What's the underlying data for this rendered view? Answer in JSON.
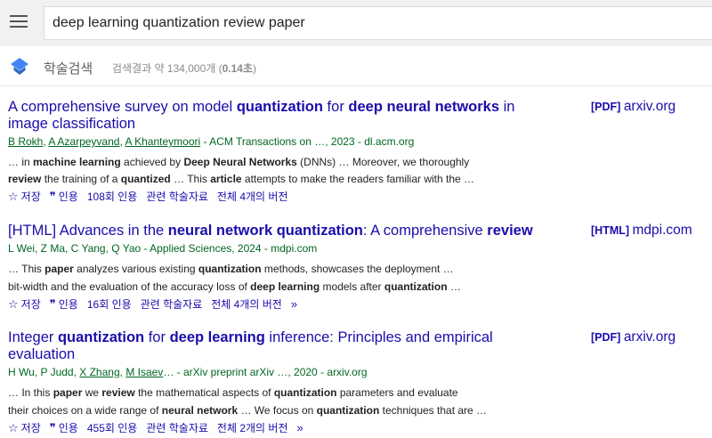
{
  "search": {
    "query": "deep learning quantization review paper"
  },
  "header": {
    "brand": "학술검색",
    "result_count_prefix": "검색결과 약 134,000개 (",
    "result_time": "0.14초",
    "result_count_suffix": ")"
  },
  "actions": {
    "save": "저장",
    "cite": "인용",
    "related": "관련 학술자료"
  },
  "results": [
    {
      "title_parts": [
        {
          "t": "A comprehensive survey on model ",
          "b": false
        },
        {
          "t": "quantization",
          "b": true
        },
        {
          "t": " for ",
          "b": false
        },
        {
          "t": "deep neural networks",
          "b": true
        },
        {
          "t": " in image classification",
          "b": false
        }
      ],
      "side_tag": "[PDF]",
      "side_domain": "arxiv.org",
      "author_parts": [
        {
          "t": "B Rokh",
          "link": true
        },
        {
          "t": ", ",
          "link": false
        },
        {
          "t": "A Azarpeyvand",
          "link": true
        },
        {
          "t": ", ",
          "link": false
        },
        {
          "t": "A Khanteymoori",
          "link": true
        },
        {
          "t": " - ACM Transactions on …, 2023 - dl.acm.org",
          "link": false
        }
      ],
      "snippet_lines": [
        [
          {
            "t": "… in ",
            "b": false
          },
          {
            "t": "machine learning",
            "b": true
          },
          {
            "t": " achieved by ",
            "b": false
          },
          {
            "t": "Deep Neural Networks",
            "b": true
          },
          {
            "t": " (DNNs) … Moreover, we thoroughly",
            "b": false
          }
        ],
        [
          {
            "t": "review",
            "b": true
          },
          {
            "t": " the training of a ",
            "b": false
          },
          {
            "t": "quantized",
            "b": true
          },
          {
            "t": " … This ",
            "b": false
          },
          {
            "t": "article",
            "b": true
          },
          {
            "t": " attempts to make the readers familiar with the …",
            "b": false
          }
        ]
      ],
      "cited": "108회 인용",
      "versions": "전체 4개의 버전",
      "more": false
    },
    {
      "title_parts": [
        {
          "t": "[HTML] ",
          "b": false
        },
        {
          "t": "Advances in the ",
          "b": false
        },
        {
          "t": "neural network quantization",
          "b": true
        },
        {
          "t": ": A comprehensive ",
          "b": false
        },
        {
          "t": "review",
          "b": true
        }
      ],
      "side_tag": "[HTML]",
      "side_domain": "mdpi.com",
      "author_parts": [
        {
          "t": "L Wei, Z Ma, C Yang, Q Yao - Applied Sciences, 2024 - mdpi.com",
          "link": false
        }
      ],
      "snippet_lines": [
        [
          {
            "t": "… This ",
            "b": false
          },
          {
            "t": "paper",
            "b": true
          },
          {
            "t": " analyzes various existing ",
            "b": false
          },
          {
            "t": "quantization",
            "b": true
          },
          {
            "t": " methods, showcases the deployment …",
            "b": false
          }
        ],
        [
          {
            "t": "bit-width and the evaluation of the accuracy loss of ",
            "b": false
          },
          {
            "t": "deep learning",
            "b": true
          },
          {
            "t": " models after ",
            "b": false
          },
          {
            "t": "quantization",
            "b": true
          },
          {
            "t": " …",
            "b": false
          }
        ]
      ],
      "cited": "16회 인용",
      "versions": "전체 4개의 버전",
      "more": true
    },
    {
      "title_parts": [
        {
          "t": "Integer ",
          "b": false
        },
        {
          "t": "quantization",
          "b": true
        },
        {
          "t": " for ",
          "b": false
        },
        {
          "t": "deep learning",
          "b": true
        },
        {
          "t": " inference: Principles and empirical evaluation",
          "b": false
        }
      ],
      "side_tag": "[PDF]",
      "side_domain": "arxiv.org",
      "author_parts": [
        {
          "t": "H Wu, P Judd, ",
          "link": false
        },
        {
          "t": "X Zhang",
          "link": true
        },
        {
          "t": ", ",
          "link": false
        },
        {
          "t": "M Isaev",
          "link": true
        },
        {
          "t": "… - arXiv preprint arXiv …, 2020 - arxiv.org",
          "link": false
        }
      ],
      "snippet_lines": [
        [
          {
            "t": "… In this ",
            "b": false
          },
          {
            "t": "paper",
            "b": true
          },
          {
            "t": " we ",
            "b": false
          },
          {
            "t": "review",
            "b": true
          },
          {
            "t": " the mathematical aspects of ",
            "b": false
          },
          {
            "t": "quantization",
            "b": true
          },
          {
            "t": " parameters and evaluate",
            "b": false
          }
        ],
        [
          {
            "t": "their choices on a wide range of ",
            "b": false
          },
          {
            "t": "neural network",
            "b": true
          },
          {
            "t": " … We focus on ",
            "b": false
          },
          {
            "t": "quantization",
            "b": true
          },
          {
            "t": " techniques that are …",
            "b": false
          }
        ]
      ],
      "cited": "455회 인용",
      "versions": "전체 2개의 버전",
      "more": true
    }
  ]
}
